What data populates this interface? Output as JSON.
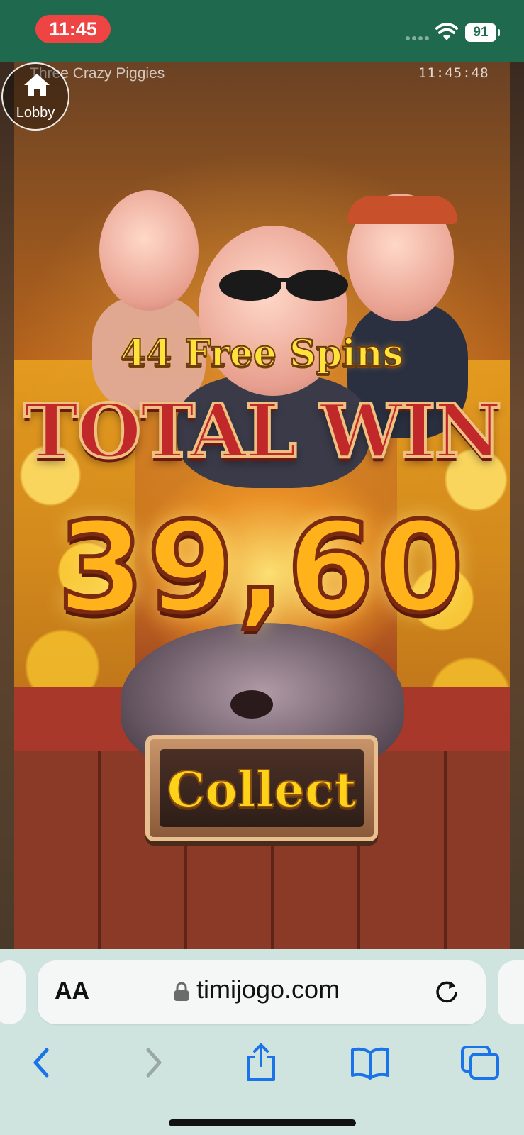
{
  "status_bar": {
    "time": "11:45",
    "battery": "91"
  },
  "game": {
    "title": "Three Crazy Piggies",
    "clock": "11:45:48",
    "lobby_label": "Lobby",
    "free_spins_text": "44 Free Spins",
    "total_win_label": "TOTAL WIN",
    "win_amount": "39,60",
    "collect_label": "Collect"
  },
  "browser": {
    "text_size_label": "AA",
    "url": "timijogo.com"
  },
  "icons": {
    "lobby": "home-icon",
    "lock": "lock-icon",
    "reload": "reload-icon",
    "back": "chevron-left-icon",
    "forward": "chevron-right-icon",
    "share": "share-icon",
    "bookmarks": "book-icon",
    "tabs": "tabs-icon"
  },
  "colors": {
    "status_bar": "#1f6a4e",
    "time_pill": "#ef4444",
    "toolbar_accent": "#1a73e8",
    "toolbar_disabled": "#9aa8a6"
  }
}
